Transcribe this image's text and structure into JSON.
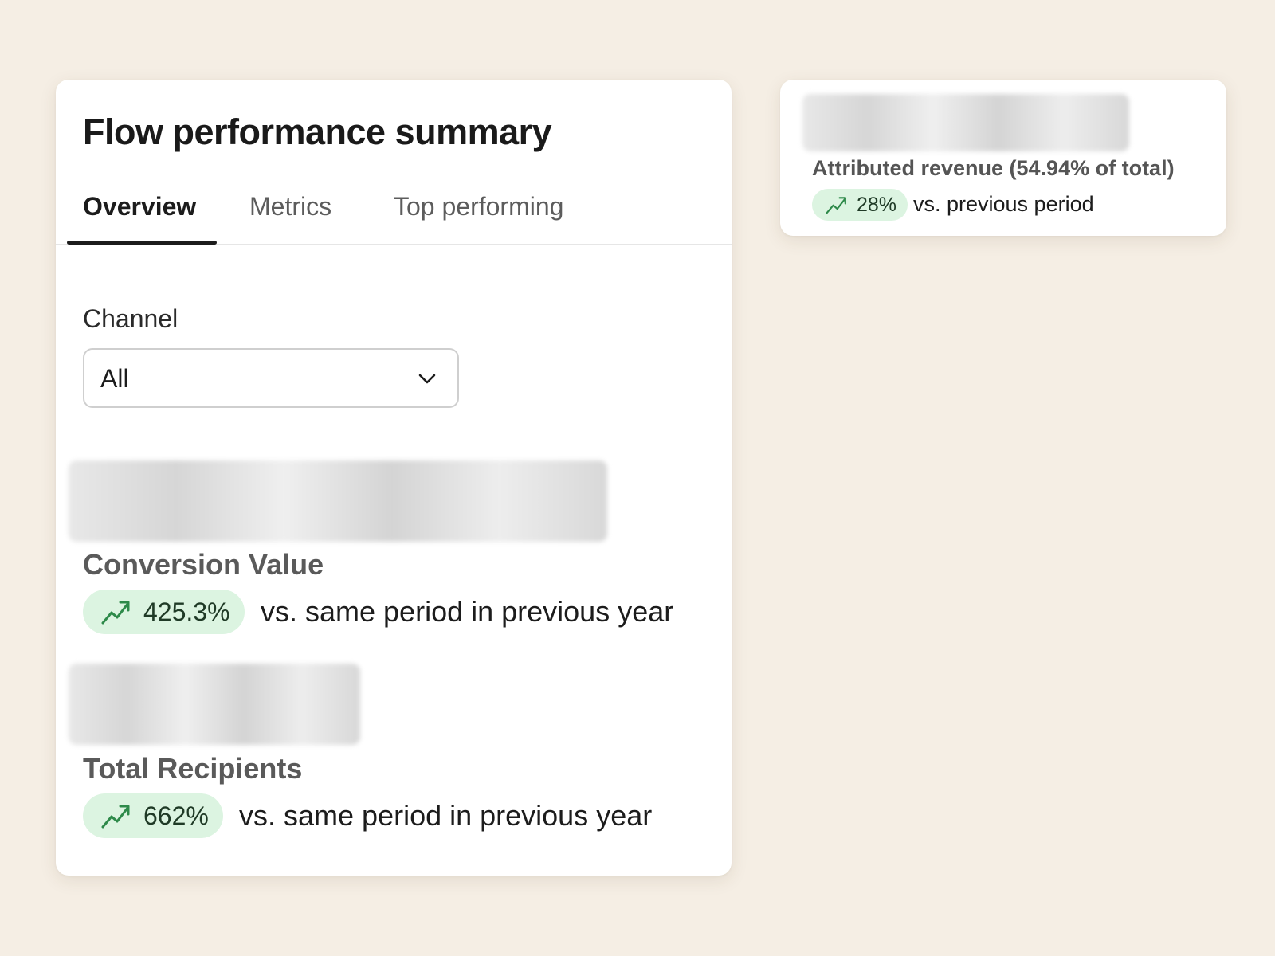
{
  "main_card": {
    "title": "Flow performance summary",
    "tabs": [
      {
        "label": "Overview",
        "active": true
      },
      {
        "label": "Metrics",
        "active": false
      },
      {
        "label": "Top performing",
        "active": false
      }
    ],
    "channel": {
      "label": "Channel",
      "selected": "All"
    },
    "metrics": [
      {
        "label": "Conversion Value",
        "change": "425.3%",
        "comparison": "vs. same period in previous year"
      },
      {
        "label": "Total Recipients",
        "change": "662%",
        "comparison": "vs. same period in previous year"
      }
    ]
  },
  "side_card": {
    "label": "Attributed revenue (54.94% of total)",
    "change": "28%",
    "comparison": "vs. previous period"
  },
  "icons": {
    "trend": "trend-up-icon",
    "dropdown": "chevron-down-icon"
  },
  "colors": {
    "background": "#f5eee4",
    "pill_bg": "#dcf4e1",
    "trend_green": "#2e8a4a"
  }
}
